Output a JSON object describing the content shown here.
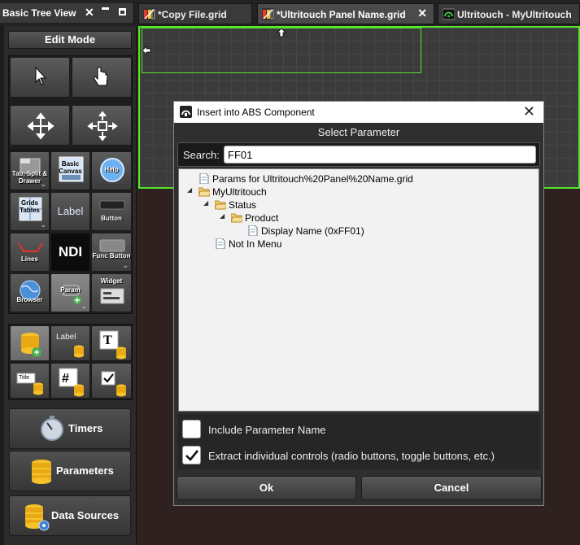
{
  "panel": {
    "title": "Basic Tree View"
  },
  "tabs": [
    {
      "label": "*Copy File.grid",
      "active": false
    },
    {
      "label": "*Ultritouch Panel Name.grid",
      "active": true
    },
    {
      "label": "Ultritouch - MyUltritouch",
      "active": false
    }
  ],
  "left_panel": {
    "edit_mode_label": "Edit Mode",
    "widget_buttons": {
      "tab_split_drawer": "Tab, Split & Drawer",
      "basic_canvas": "Basic Canvas",
      "help": "Help",
      "grids_tables": "Grids Tables",
      "label": "Label",
      "button": "Button",
      "lines": "Lines",
      "ndi": "NDI",
      "func_button": "Func Button",
      "browser": "Browser",
      "param": "Param",
      "widget": "Widget"
    },
    "param_buttons": {
      "label": "Label",
      "tile": "Title"
    },
    "bottom_buttons": {
      "timers": "Timers",
      "parameters": "Parameters",
      "data_sources": "Data Sources"
    }
  },
  "dialog": {
    "title": "Insert into ABS Component",
    "subtitle": "Select Parameter",
    "search_label": "Search:",
    "search_value": "FF01",
    "tree": {
      "root_file": "Params for Ultritouch%20Panel%20Name.grid",
      "myultritouch": "MyUltritouch",
      "status": "Status",
      "product": "Product",
      "display_name": "Display Name (0xFF01)",
      "not_in_menu": "Not In Menu"
    },
    "option_include_name": {
      "label": "Include Parameter Name",
      "checked": false
    },
    "option_extract": {
      "label": "Extract individual controls (radio buttons, toggle buttons, etc.)",
      "checked": true
    },
    "ok_label": "Ok",
    "cancel_label": "Cancel"
  },
  "colors": {
    "accent_green": "#55e62a",
    "dialog_bg": "#2f2f2f",
    "canvas_bg": "#3b3b3b",
    "desktop_bg": "#2e2120"
  }
}
